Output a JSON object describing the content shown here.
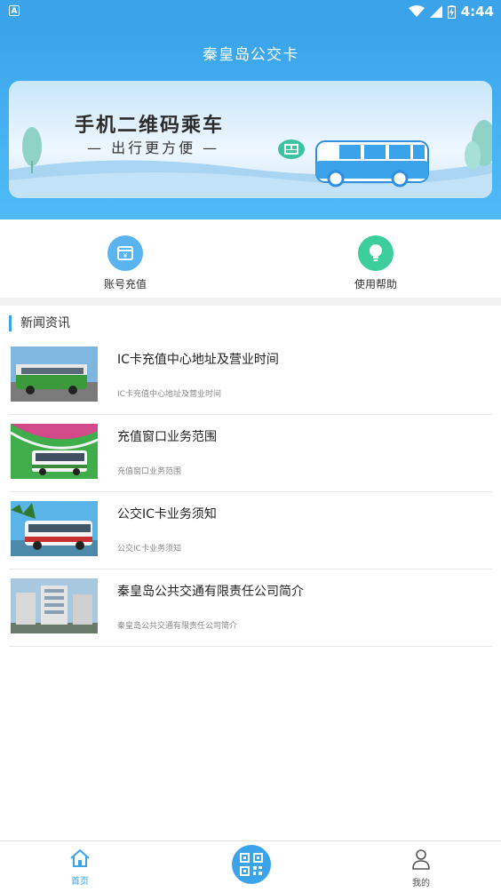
{
  "status_bar": {
    "time": "4:44",
    "app_badge": "A"
  },
  "header": {
    "title": "秦皇岛公交卡"
  },
  "banner": {
    "headline": "手机二维码乘车",
    "subline": "— 出行更方便 —"
  },
  "quick_actions": [
    {
      "label": "账号充值",
      "icon": "wallet-icon",
      "color": "#5ab4f2"
    },
    {
      "label": "使用帮助",
      "icon": "lightbulb-icon",
      "color": "#3ccf9b"
    }
  ],
  "news": {
    "section_title": "新闻资讯",
    "items": [
      {
        "title": "IC卡充值中心地址及营业时间",
        "summary": "IC卡充值中心地址及营业时间"
      },
      {
        "title": "充值窗口业务范围",
        "summary": "充值窗口业务范围"
      },
      {
        "title": "公交IC卡业务须知",
        "summary": "公交IC卡业务须知"
      },
      {
        "title": "秦皇岛公共交通有限责任公司简介",
        "summary": "秦皇岛公共交通有限责任公司简介"
      }
    ]
  },
  "bottom_nav": {
    "home_label": "首页",
    "mine_label": "我的",
    "active_color": "#3aa3ea",
    "inactive_color": "#555555"
  }
}
